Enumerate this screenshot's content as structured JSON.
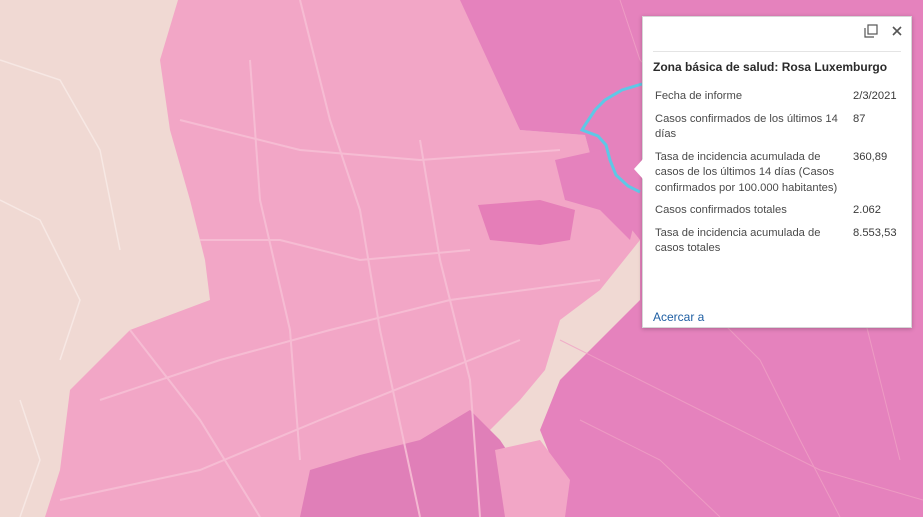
{
  "map": {
    "colors": {
      "background": "#f0d9d3",
      "zone_light": "#f2a6c6",
      "zone_mid": "#ee95bd",
      "zone_dark": "#e582bd",
      "road": "#f7bfd5",
      "highlight": "#5ec8e6"
    }
  },
  "popup": {
    "title": "Zona básica de salud: Rosa Luxemburgo",
    "fields": [
      {
        "key": "Fecha de informe",
        "value": "2/3/2021"
      },
      {
        "key": "Casos confirmados de los últimos 14 días",
        "value": "87"
      },
      {
        "key": "Tasa de incidencia acumulada de casos de los últimos 14 días (Casos confirmados por 100.000 habitantes)",
        "value": "360,89"
      },
      {
        "key": "Casos confirmados totales",
        "value": "2.062"
      },
      {
        "key": "Tasa de incidencia acumulada de casos totales",
        "value": "8.553,53"
      }
    ],
    "zoom_link": "Acercar a",
    "icons": {
      "maximize": "maximize-icon",
      "close": "close-icon"
    }
  }
}
